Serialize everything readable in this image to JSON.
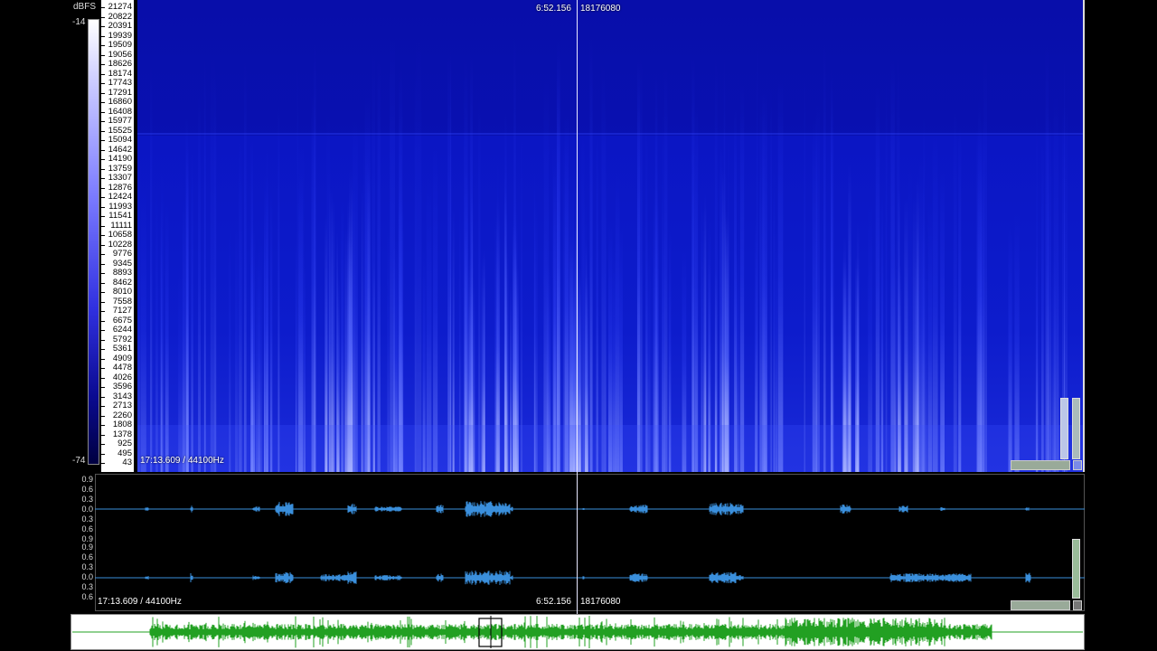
{
  "spectrogram": {
    "dbfs_unit": "dBFS",
    "db_max": "-14",
    "db_min": "-74",
    "frequency_ticks": [
      "21274",
      "20822",
      "20391",
      "19939",
      "19509",
      "19056",
      "18626",
      "18174",
      "17743",
      "17291",
      "16860",
      "16408",
      "15977",
      "15525",
      "15094",
      "14642",
      "14190",
      "13759",
      "13307",
      "12876",
      "12424",
      "11993",
      "11541",
      "11111",
      "10658",
      "10228",
      "9776",
      "9345",
      "8893",
      "8462",
      "8010",
      "7558",
      "7127",
      "6675",
      "6244",
      "5792",
      "5361",
      "4909",
      "4478",
      "4026",
      "3596",
      "3143",
      "2713",
      "2260",
      "1808",
      "1378",
      "925",
      "495",
      "43"
    ],
    "cursor_time": "6:52.156",
    "cursor_sample": "18176080",
    "duration_rate": "17:13.609 / 44100Hz",
    "accent_color": "#1a2ad8"
  },
  "waveform": {
    "amp_ticks_ch1": [
      "0.9",
      "0.6",
      "0.3",
      "0.0",
      "0.3",
      "0.6",
      "0.9"
    ],
    "amp_ticks_ch2": [
      "0.9",
      "0.6",
      "0.3",
      "0.0",
      "0.3",
      "0.6"
    ],
    "cursor_time": "6:52.156",
    "cursor_sample": "18176080",
    "duration_rate": "17:13.609 / 44100Hz",
    "wave_color": "#3a8fdc"
  },
  "overview": {
    "wave_color": "#22a022"
  }
}
